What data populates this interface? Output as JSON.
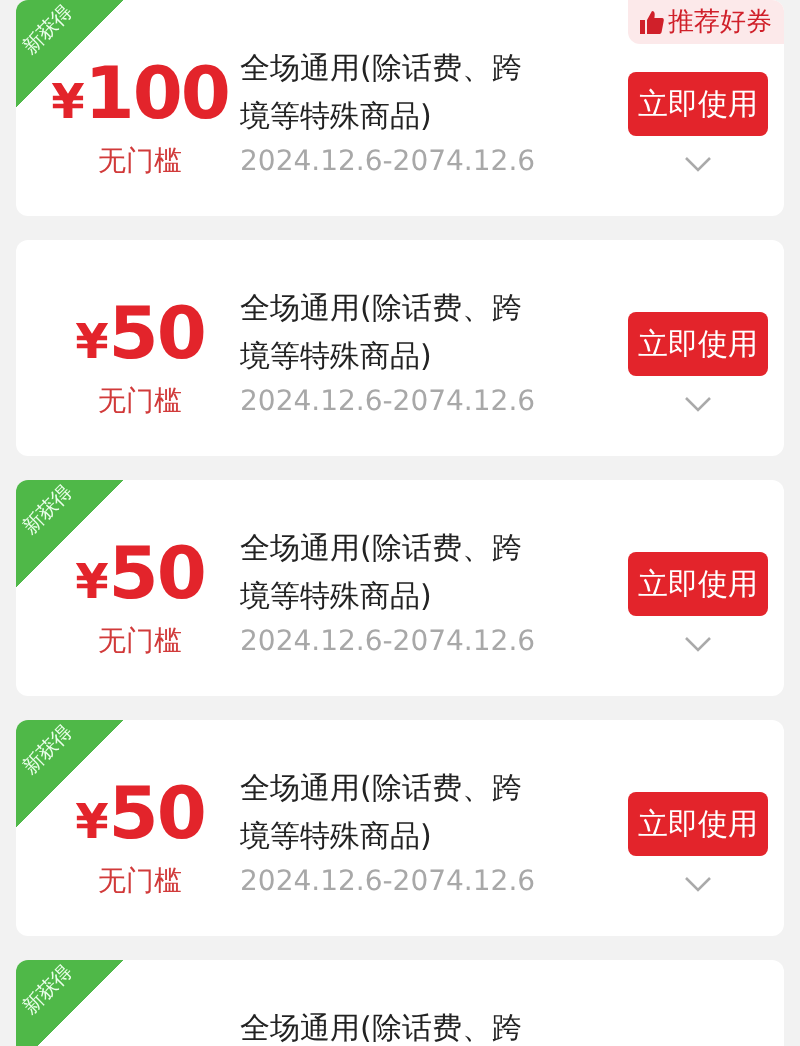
{
  "coupons": [
    {
      "kind": "full",
      "new": true,
      "ribbon": "新获得",
      "tag": "推荐好券",
      "currency": "¥",
      "amount": "100",
      "threshold": "无门槛",
      "title": "全场通用(除话费、跨境等特殊商品)",
      "dates": "2024.12.6-2074.12.6",
      "button": "立即使用"
    },
    {
      "kind": "full",
      "new": false,
      "currency": "¥",
      "amount": "50",
      "threshold": "无门槛",
      "title": "全场通用(除话费、跨境等特殊商品)",
      "dates": "2024.12.6-2074.12.6",
      "button": "立即使用"
    },
    {
      "kind": "full",
      "new": true,
      "ribbon": "新获得",
      "currency": "¥",
      "amount": "50",
      "threshold": "无门槛",
      "title": "全场通用(除话费、跨境等特殊商品)",
      "dates": "2024.12.6-2074.12.6",
      "button": "立即使用"
    },
    {
      "kind": "full",
      "new": true,
      "ribbon": "新获得",
      "currency": "¥",
      "amount": "50",
      "threshold": "无门槛",
      "title": "全场通用(除话费、跨境等特殊商品)",
      "dates": "2024.12.6-2074.12.6",
      "button": "立即使用"
    },
    {
      "kind": "partial",
      "new": true,
      "ribbon": "新获得",
      "title": "全场通用(除话费、跨"
    }
  ]
}
